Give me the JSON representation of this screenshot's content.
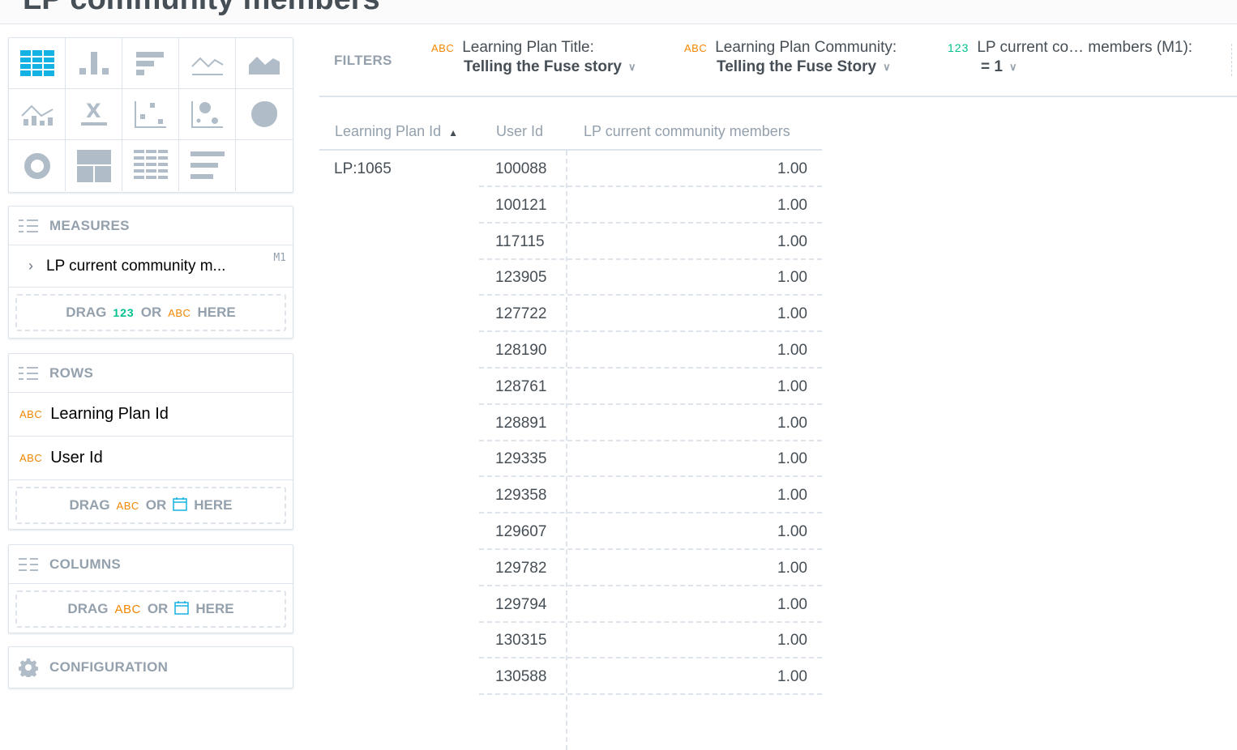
{
  "header": {
    "title": "LP community members"
  },
  "vis_types": [
    "table-icon",
    "bar-chart-icon",
    "bar-horizontal-icon",
    "line-chart-icon",
    "area-chart-icon",
    "combo-chart-icon",
    "headline-icon",
    "scatter-icon",
    "bubble-icon",
    "pie-icon",
    "donut-icon",
    "treemap-icon",
    "heatmap-icon",
    "bullet-icon"
  ],
  "measures": {
    "title": "MEASURES",
    "item_label": "LP current community m...",
    "item_id": "M1",
    "drop": {
      "drag": "DRAG",
      "num": "123",
      "or": "OR",
      "abc": "ABC",
      "here": "HERE"
    }
  },
  "rows": {
    "title": "ROWS",
    "items": [
      {
        "type": "ABC",
        "label": "Learning Plan Id"
      },
      {
        "type": "ABC",
        "label": "User Id"
      }
    ],
    "drop": {
      "drag": "DRAG",
      "abc": "ABC",
      "or": "OR",
      "here": "HERE"
    }
  },
  "columns": {
    "title": "COLUMNS",
    "drop": {
      "drag": "DRAG",
      "abc": "ABC",
      "or": "OR",
      "here": "HERE"
    }
  },
  "configuration": {
    "title": "CONFIGURATION"
  },
  "filters": {
    "label": "FILTERS",
    "items": [
      {
        "type": "ABC",
        "title": "Learning Plan Title:",
        "value": "Telling the Fuse story"
      },
      {
        "type": "ABC",
        "title": "Learning Plan Community:",
        "value": "Telling the Fuse Story"
      },
      {
        "type": "123",
        "title": "LP current co… members (M1):",
        "value": "= 1"
      }
    ]
  },
  "table": {
    "columns": [
      "Learning Plan Id",
      "User Id",
      "LP current community members"
    ],
    "sort_indicator": "▲",
    "group_value": "LP:1065",
    "rows": [
      {
        "user_id": "100088",
        "value": "1.00"
      },
      {
        "user_id": "100121",
        "value": "1.00"
      },
      {
        "user_id": "117115",
        "value": "1.00"
      },
      {
        "user_id": "123905",
        "value": "1.00"
      },
      {
        "user_id": "127722",
        "value": "1.00"
      },
      {
        "user_id": "128190",
        "value": "1.00"
      },
      {
        "user_id": "128761",
        "value": "1.00"
      },
      {
        "user_id": "128891",
        "value": "1.00"
      },
      {
        "user_id": "129335",
        "value": "1.00"
      },
      {
        "user_id": "129358",
        "value": "1.00"
      },
      {
        "user_id": "129607",
        "value": "1.00"
      },
      {
        "user_id": "129782",
        "value": "1.00"
      },
      {
        "user_id": "129794",
        "value": "1.00"
      },
      {
        "user_id": "130315",
        "value": "1.00"
      },
      {
        "user_id": "130588",
        "value": "1.00"
      }
    ]
  },
  "colors": {
    "accent": "#14b2e2",
    "abc": "#f18600",
    "num": "#00c18d",
    "muted": "#94a1ad",
    "border": "#dde4eb"
  }
}
